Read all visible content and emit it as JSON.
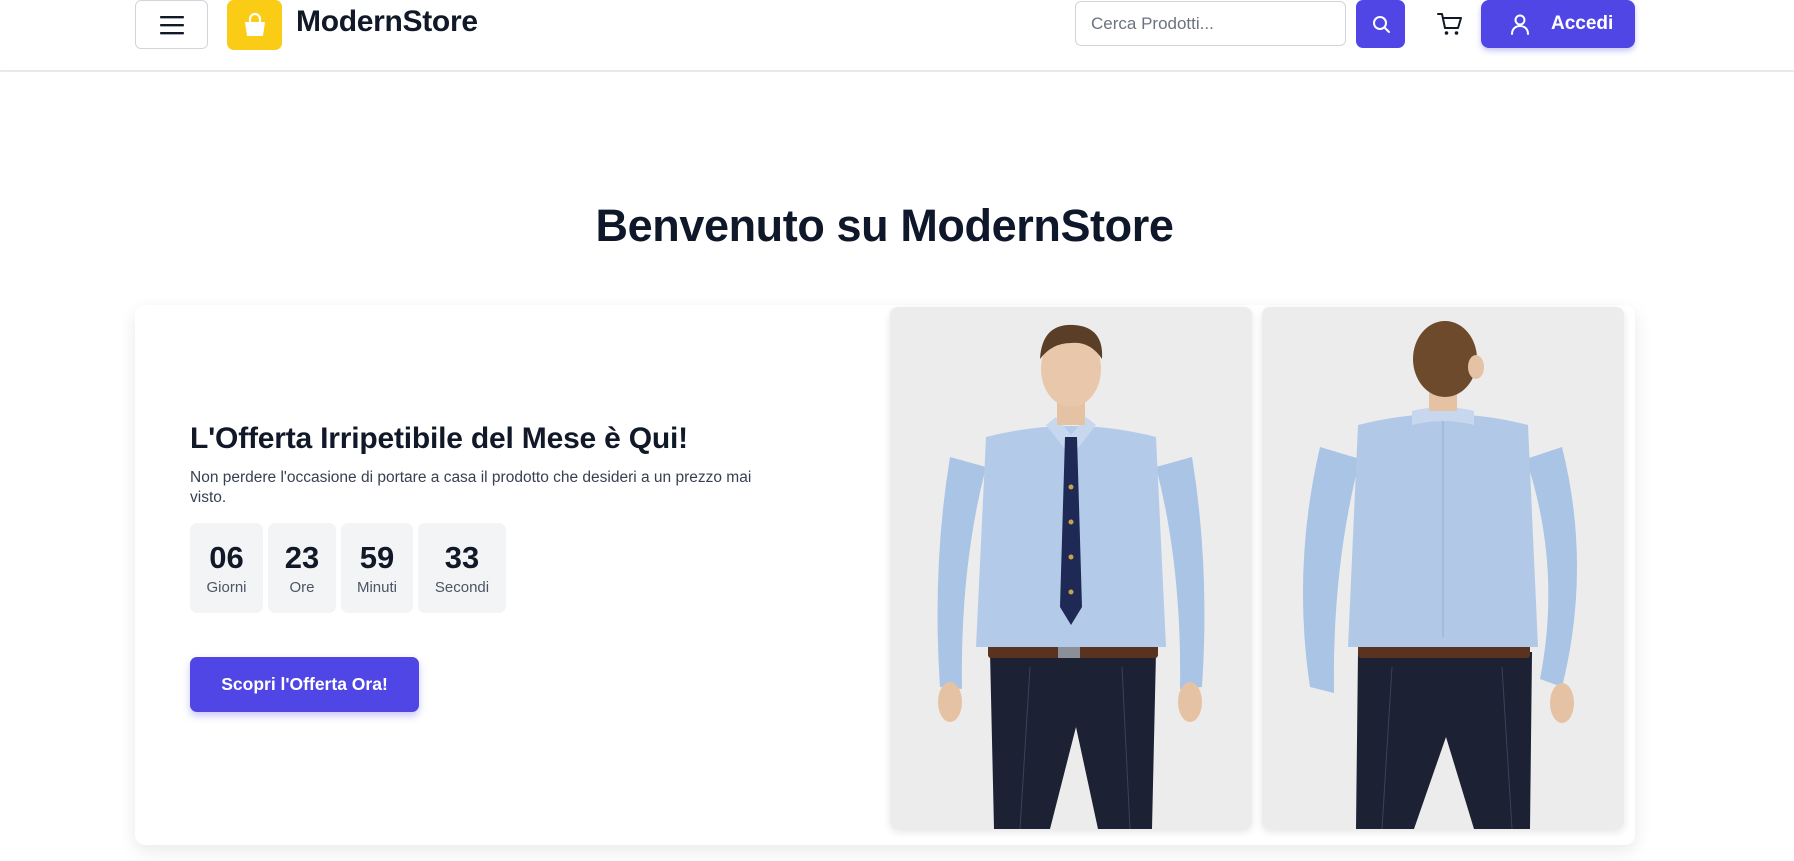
{
  "header": {
    "brand": "ModernStore",
    "search_placeholder": "Cerca Prodotti...",
    "login_label": "Accedi",
    "icons": [
      "menu-icon",
      "shopping-bag-icon",
      "search-icon",
      "cart-icon",
      "user-icon"
    ]
  },
  "main": {
    "title": "Benvenuto su ModernStore",
    "offer": {
      "heading": "L'Offerta Irripetibile del Mese è Qui!",
      "text": "Non perdere l'occasione di portare a casa il prodotto che desideri a un prezzo mai visto.",
      "countdown": [
        {
          "value": "06",
          "label": "Giorni"
        },
        {
          "value": "23",
          "label": "Ore"
        },
        {
          "value": "59",
          "label": "Minuti"
        },
        {
          "value": "33",
          "label": "Secondi"
        }
      ],
      "cta_label": "Scopri l'Offerta Ora!"
    }
  },
  "colors": {
    "accent": "#4f46e5",
    "logo_bg": "#facc15",
    "text_dark": "#111827",
    "shirt": "#a9c4e4",
    "trousers": "#1c2233"
  }
}
